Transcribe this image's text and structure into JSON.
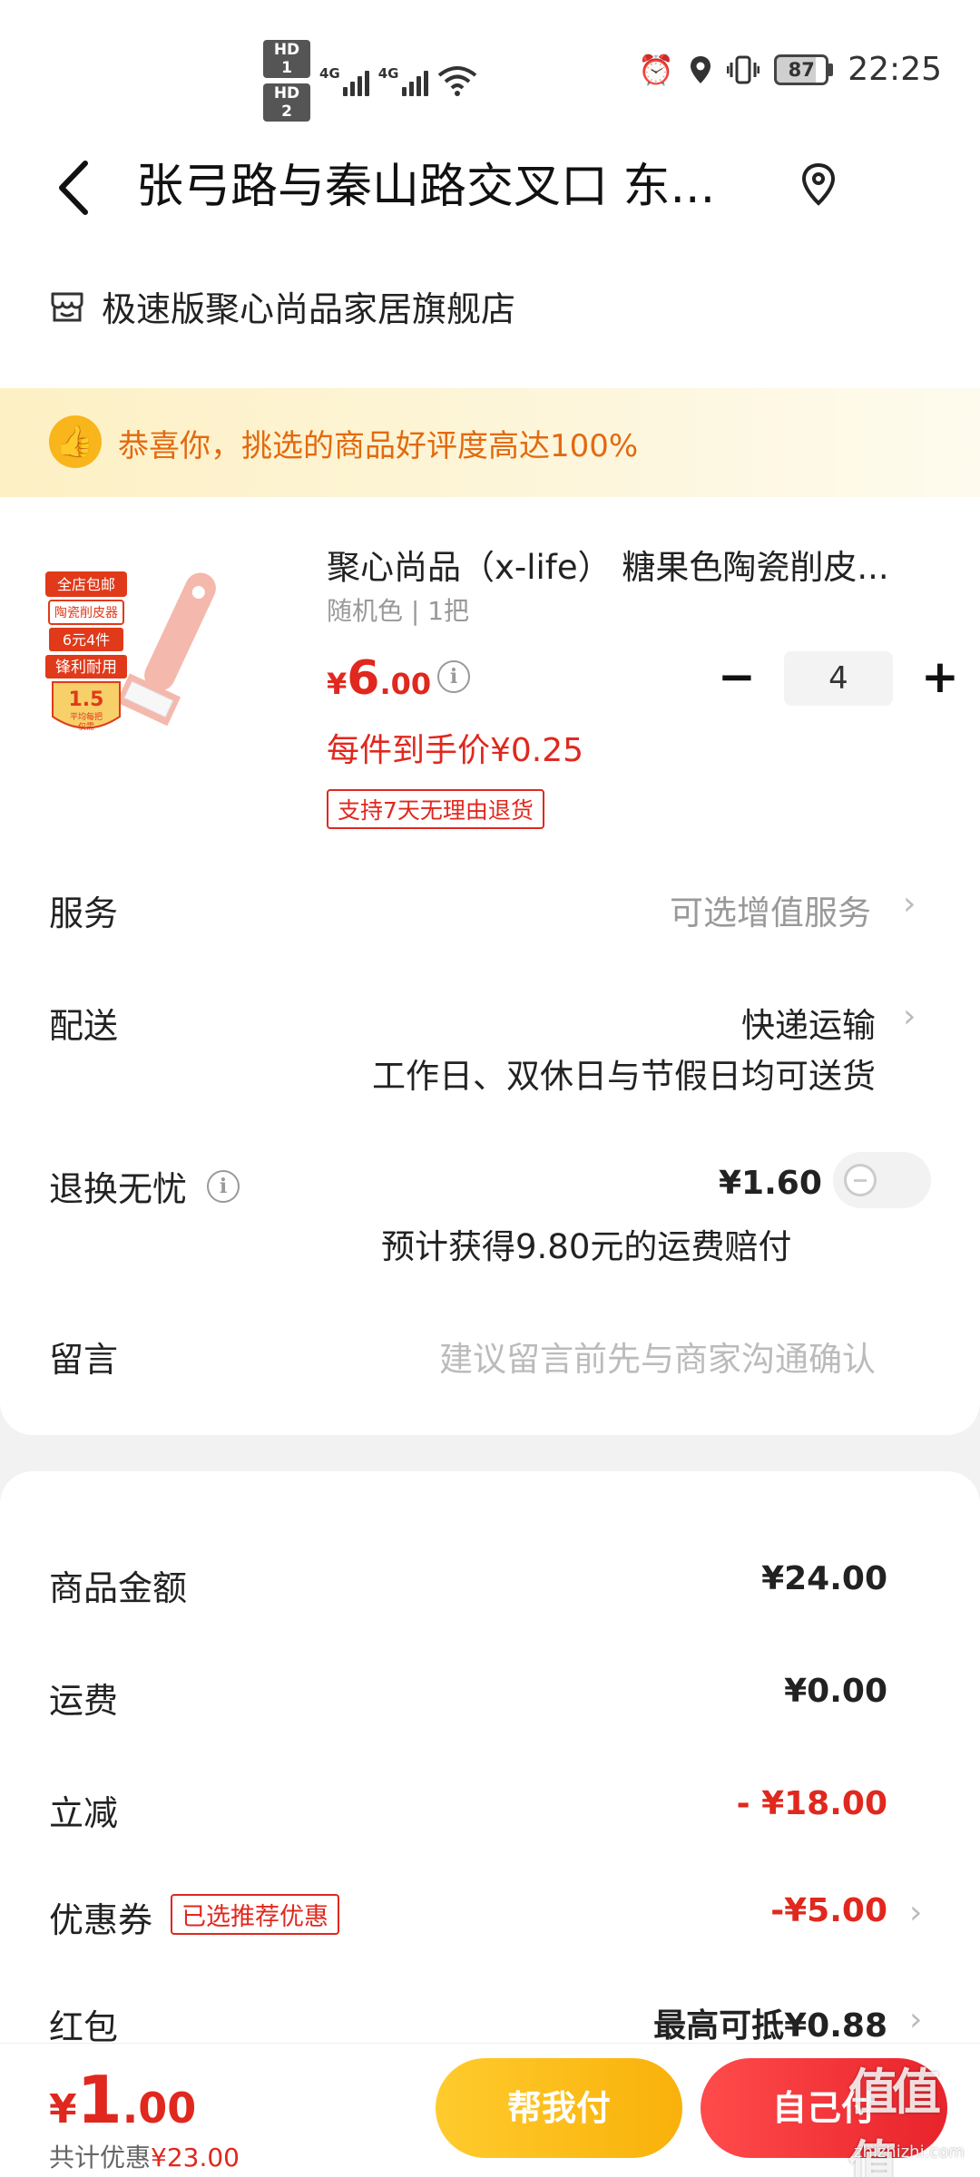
{
  "status_bar": {
    "hd1": "HD 1",
    "hd2": "HD 2",
    "net1": "4G",
    "net2": "4G",
    "battery": "87",
    "time": "22:25"
  },
  "header": {
    "title": "张弓路与秦山路交叉口 东..."
  },
  "store": {
    "name": "极速版聚心尚品家居旗舰店"
  },
  "banner": {
    "text": "恭喜你，挑选的商品好评度高达100%"
  },
  "product": {
    "title": "聚心尚品（x-life） 糖果色陶瓷削皮...",
    "spec": "随机色 | 1把",
    "price_currency": "¥",
    "price_int": "6",
    "price_dec": ".00",
    "unit_price": "每件到手价¥0.25",
    "tag": "支持7天无理由退货",
    "quantity": "4",
    "minus": "−",
    "plus": "+",
    "image_badges": [
      "全店包邮",
      "陶瓷削皮器",
      "6元4件",
      "锋利耐用",
      "1.5",
      "平均每把",
      "仅需"
    ]
  },
  "rows": {
    "service_label": "服务",
    "service_value": "可选增值服务",
    "delivery_label": "配送",
    "delivery_value": "快递运输",
    "delivery_sub": "工作日、双休日与节假日均可送货",
    "return_label": "退换无忧",
    "return_price": "¥1.60",
    "return_sub": "预计获得9.80元的运费赔付",
    "message_label": "留言",
    "message_placeholder": "建议留言前先与商家沟通确认"
  },
  "fees": {
    "goods_label": "商品金额",
    "goods_amount": "¥24.00",
    "shipping_label": "运费",
    "shipping_amount": "¥0.00",
    "discount_label": "立减",
    "discount_amount": "- ¥18.00",
    "coupon_label": "优惠券",
    "coupon_tag": "已选推荐优惠",
    "coupon_amount": "-¥5.00",
    "redpacket_label": "红包",
    "redpacket_amount": "最高可抵¥0.88"
  },
  "bottom": {
    "currency": "¥",
    "total_int": "1",
    "total_dec": ".00",
    "saved_prefix": "共计优惠",
    "saved_amount": "¥23.00",
    "help_pay": "帮我付",
    "self_pay": "自己付"
  },
  "watermark": {
    "glyphs": "值值值",
    "url": "zhizhizhi.com"
  },
  "colors": {
    "accent_red": "#e0281e",
    "help_yellow": "#f9b10a",
    "banner_orange": "#e26a10"
  }
}
